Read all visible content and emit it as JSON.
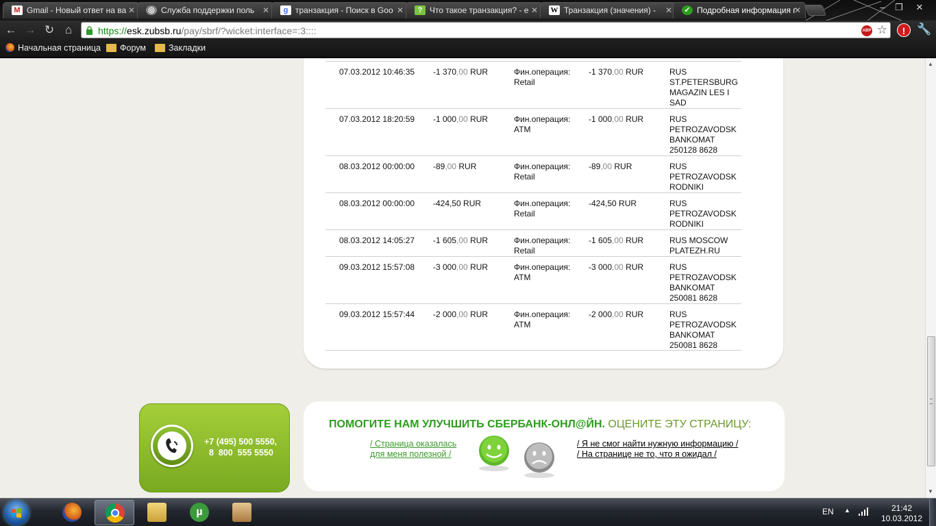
{
  "browser": {
    "tabs": [
      {
        "title": "Gmail - Новый ответ на ва",
        "icon": "gmail-icon"
      },
      {
        "title": "Служба поддержки поль",
        "icon": "support-icon"
      },
      {
        "title": "транзакция - Поиск в Goo",
        "icon": "google-icon"
      },
      {
        "title": "Что такое транзакция? - е",
        "icon": "answers-icon"
      },
      {
        "title": "Транзакция (значения) -",
        "icon": "wikipedia-icon"
      },
      {
        "title": "Подробная информация г",
        "icon": "sberbank-icon"
      }
    ],
    "url": {
      "scheme": "https://",
      "host": "esk.zubsb.ru",
      "path": "/pay/sbrf/?wicket:interface=:3::::"
    },
    "abp_label": "ABP",
    "bookmarks": [
      {
        "label": "Начальная страница",
        "icon": "firefox-icon"
      },
      {
        "label": "Форум",
        "icon": "folder-icon"
      },
      {
        "label": "Закладки",
        "icon": "folder-icon"
      }
    ]
  },
  "transactions": [
    {
      "date": "07.03.2012 10:46:35",
      "amount_main": "-1 370",
      "amount_kop": ",00",
      "currency": "RUR",
      "type": "Фин.операция: Retail",
      "amount2_main": "-1 370",
      "amount2_kop": ",00",
      "currency2": "RUR",
      "location": "RUS ST.PETERSBURG MAGAZIN LES I SAD",
      "height": 69
    },
    {
      "date": "07.03.2012 18:20:59",
      "amount_main": "-1 000",
      "amount_kop": ",00",
      "currency": "RUR",
      "type": "Фин.операция: ATM",
      "amount2_main": "-1 000",
      "amount2_kop": ",00",
      "currency2": "RUR",
      "location": "RUS PETROZAVODSK BANKOMAT 250128 8628",
      "height": 69
    },
    {
      "date": "08.03.2012 00:00:00",
      "amount_main": "-89",
      "amount_kop": ",00",
      "currency": "RUR",
      "type": "Фин.операция: Retail",
      "amount2_main": "-89",
      "amount2_kop": ",00",
      "currency2": "RUR",
      "location": "RUS PETROZAVODSK RODNIKI",
      "height": 54
    },
    {
      "date": "08.03.2012 00:00:00",
      "amount_main": "-424,50",
      "amount_kop": "",
      "currency": "RUR",
      "type": "Фин.операция: Retail",
      "amount2_main": "-424,50",
      "amount2_kop": "",
      "currency2": "RUR",
      "location": "RUS PETROZAVODSK RODNIKI",
      "height": 54
    },
    {
      "date": "08.03.2012 14:05:27",
      "amount_main": "-1 605",
      "amount_kop": ",00",
      "currency": "RUR",
      "type": "Фин.операция: Retail",
      "amount2_main": "-1 605",
      "amount2_kop": ",00",
      "currency2": "RUR",
      "location": "RUS MOSCOW PLATEZH.RU",
      "height": 39
    },
    {
      "date": "09.03.2012 15:57:08",
      "amount_main": "-3 000",
      "amount_kop": ",00",
      "currency": "RUR",
      "type": "Фин.операция: ATM",
      "amount2_main": "-3 000",
      "amount2_kop": ",00",
      "currency2": "RUR",
      "location": "RUS PETROZAVODSK BANKOMAT 250081 8628",
      "height": 69
    },
    {
      "date": "09.03.2012 15:57:44",
      "amount_main": "-2 000",
      "amount_kop": ",00",
      "currency": "RUR",
      "type": "Фин.операция: ATM",
      "amount2_main": "-2 000",
      "amount2_kop": ",00",
      "currency2": "RUR",
      "location": "RUS PETROZAVODSK BANKOMAT 250081 8628",
      "height": 69
    }
  ],
  "contact": {
    "phone": "+7 (495) 500 5550,\n  8  800  555 5550"
  },
  "survey": {
    "title_bold": "ПОМОГИТЕ НАМ УЛУЧШИТЬ СБЕРБАНК-ОНЛ@ЙН.",
    "title_rest": " ОЦЕНИТЕ ЭТУ СТРАНИЦУ:",
    "positive": "/ Страница оказалась для меня полезной /",
    "negative_1": "/ Я не смог найти нужную информацию /",
    "negative_2": "/ На странице не то, что я ожидал /"
  },
  "taskbar": {
    "apps": [
      "firefox-icon",
      "chrome-icon",
      "explorer-icon",
      "utorrent-icon",
      "game-icon"
    ],
    "language": "EN",
    "time": "21:42",
    "date": "10.03.2012"
  },
  "colors": {
    "sber_green": "#2e9c1f",
    "phone_green": "#8fc232",
    "page_bg": "#f0eee8"
  }
}
